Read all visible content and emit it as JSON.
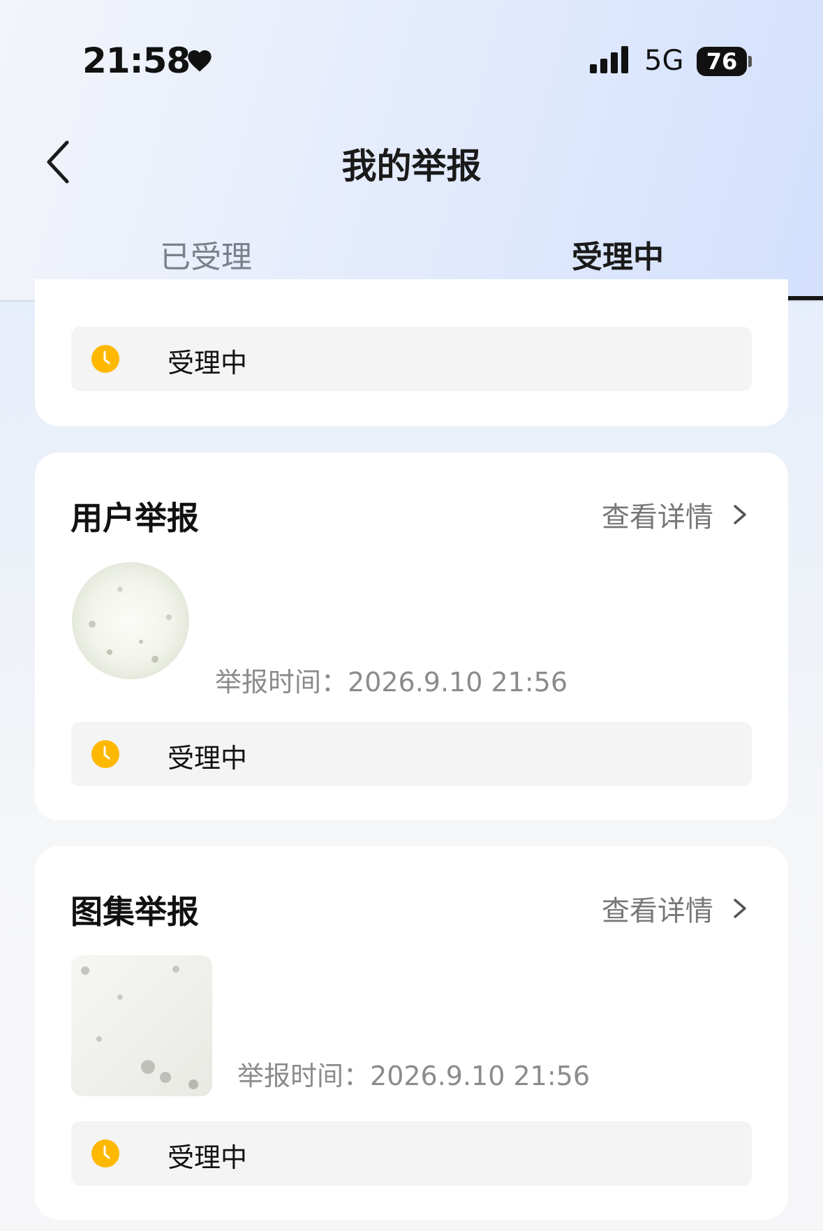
{
  "status_bar": {
    "time": "21:58",
    "network": "5G",
    "battery": "76"
  },
  "header": {
    "title": "我的举报"
  },
  "tabs": [
    {
      "label": "已受理",
      "active": false
    },
    {
      "label": "受理中",
      "active": true
    }
  ],
  "cards": [
    {
      "status": "受理中"
    },
    {
      "title": "用户举报",
      "detail_link": "查看详情",
      "thumbnail": "circular-avatar",
      "time_label": "举报时间：",
      "time_value": "2026.9.10 21:56",
      "status": "受理中"
    },
    {
      "title": "图集举报",
      "detail_link": "查看详情",
      "thumbnail": "square-image",
      "time_label": "举报时间：",
      "time_value": "2026.9.10 21:56",
      "status": "受理中"
    }
  ],
  "colors": {
    "status_icon": "#FFB800",
    "tab_indicator": "#161616",
    "muted_text": "#8B8B8B"
  }
}
